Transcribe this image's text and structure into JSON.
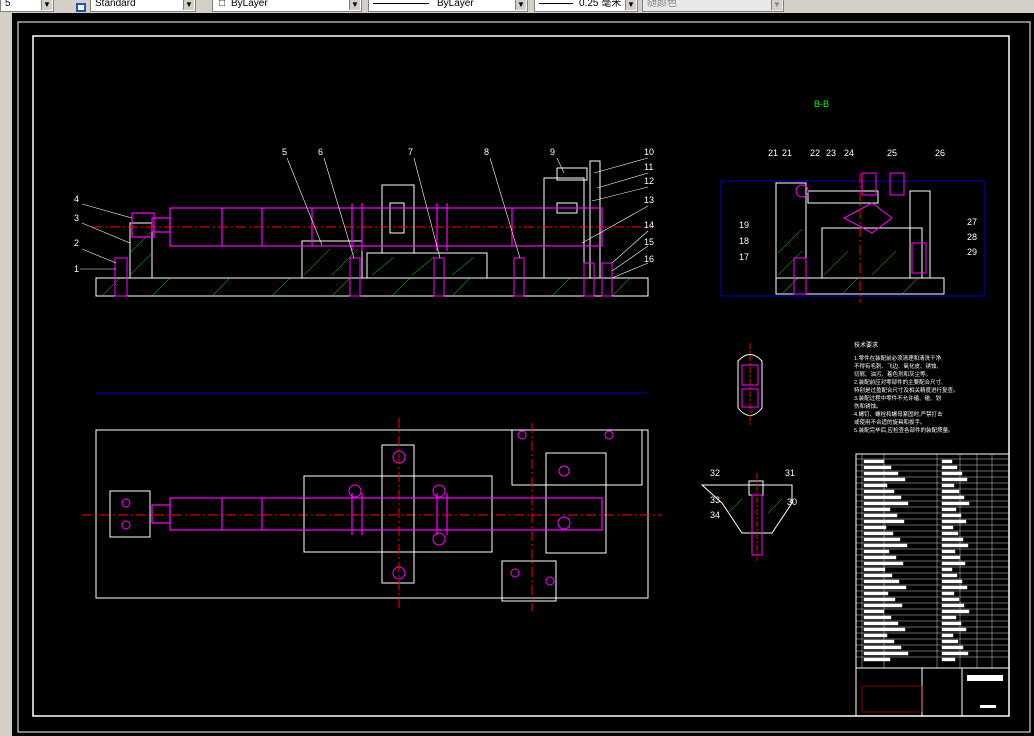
{
  "toolbar": {
    "left_fragment": "5",
    "text_style": "Standard",
    "layer": "ByLayer",
    "linetype": "ByLayer",
    "lineweight": "0.25 毫米",
    "plot_style": "随颜色"
  },
  "drawing": {
    "section_title": "B-B",
    "front_view_labels": [
      "1",
      "2",
      "3",
      "4",
      "5",
      "6",
      "7",
      "8",
      "9",
      "10",
      "11",
      "12",
      "13",
      "14",
      "15",
      "16"
    ],
    "section_view_labels": [
      "21",
      "21",
      "22",
      "23",
      "24",
      "25",
      "26",
      "19",
      "18",
      "17",
      "27",
      "28",
      "29"
    ],
    "detail_labels": [
      "32",
      "31",
      "33",
      "30",
      "34"
    ],
    "tech_req_title": "技术要求",
    "tech_req_lines": [
      "1.零件在装配前必须清理和清洗干净,",
      "不得有毛刺、飞边、氧化皮、锈蚀、",
      "切屑、油污、着色剂和灰尘等。",
      "2.装配前应对零部件的主要配合尺寸,",
      "特别是过盈配合尺寸及相关精度进行复查。",
      "3.装配过程中零件不允许磕、碰、划",
      "伤和锈蚀。",
      "4.螺钉、螺栓和螺母紧固时,严禁打击",
      "或使用不合适的旋具和扳手。",
      "5.装配完毕后,应检查各部件的装配质量。"
    ]
  },
  "colors": {
    "canvas_bg": "#000000",
    "part_magenta": "#ff00ff",
    "center_red": "#ff0000",
    "dim_blue": "#0000ff",
    "label_white": "#ffffff",
    "hatch_green": "#00ff00",
    "yellow": "#ffff00"
  }
}
